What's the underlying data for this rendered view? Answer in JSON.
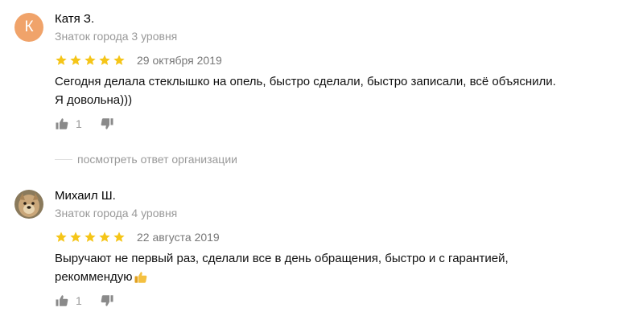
{
  "reviews": [
    {
      "avatar_letter": "К",
      "author": "Катя З.",
      "level": "Знаток города 3 уровня",
      "rating": 5,
      "date": "29 октября 2019",
      "text_line1": "Сегодня делала стеклышко на опель, быстро сделали, быстро записали, всё объяснили.",
      "text_line2": "Я довольна)))",
      "likes": "1"
    },
    {
      "author": "Михаил Ш.",
      "level": "Знаток города 4 уровня",
      "rating": 5,
      "date": "22 августа 2019",
      "text_line1": "Выручают не первый раз, сделали все в день обращения, быстро и с гарантией,",
      "text_line2": "рекоммендую",
      "likes": "1"
    }
  ],
  "org_answer_link": "посмотреть ответ организации",
  "colors": {
    "star": "#f5c518",
    "avatar_bg": "#f0a36a",
    "muted": "#999999"
  }
}
